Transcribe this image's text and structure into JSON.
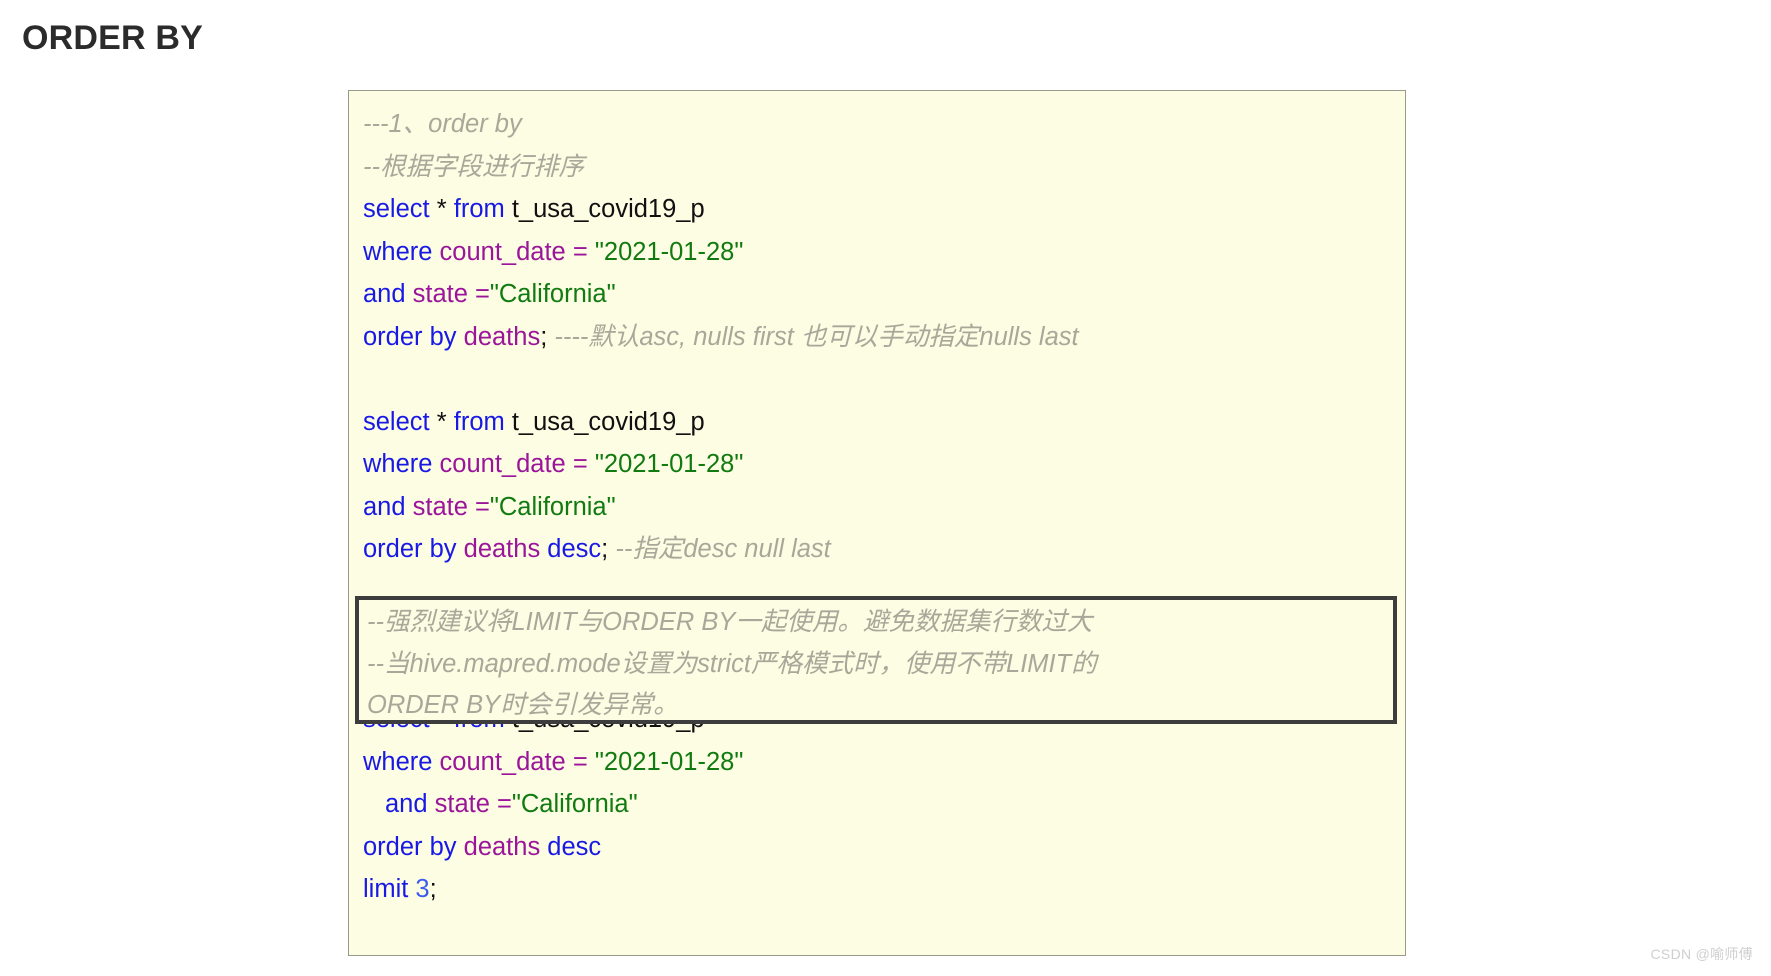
{
  "page": {
    "title": "ORDER BY",
    "watermark": "CSDN @喻师傅",
    "background_color": "#ffffff",
    "card_background_color": "#fdfde3",
    "card_border_color": "#9a9a8a",
    "warning_box_border_color": "#3d3d3d"
  },
  "syntax_colors": {
    "keyword": "#1919e6",
    "column": "#9a159a",
    "string": "#117a11",
    "plain": "#101010",
    "number": "#3b5bf0",
    "comment": "#a8a89a"
  },
  "code": {
    "block1": {
      "comment_title": "---1、order by",
      "comment_desc": "--根据字段进行排序",
      "select_kw": "select",
      "star": "*",
      "from_kw": "from",
      "table": "t_usa_covid19_p",
      "where_kw": "where",
      "col_count_date": "count_date",
      "eq": "=",
      "val_date": "\"2021-01-28\"",
      "and_kw": "and",
      "col_state": "state",
      "eq2": "=",
      "val_state": "\"California\"",
      "orderby_kw": "order by",
      "col_deaths": "deaths",
      "semicolon": ";",
      "trailing_comment": "----默认asc, nulls first 也可以手动指定nulls last"
    },
    "block2": {
      "select_kw": "select",
      "star": "*",
      "from_kw": "from",
      "table": "t_usa_covid19_p",
      "where_kw": "where",
      "col_count_date": "count_date",
      "eq": "=",
      "val_date": "\"2021-01-28\"",
      "and_kw": "and",
      "col_state": "state",
      "eq2": "=",
      "val_state": "\"California\"",
      "orderby_kw": "order by",
      "col_deaths": "deaths",
      "desc_kw": "desc",
      "semicolon": ";",
      "trailing_comment": "--指定desc null last"
    },
    "warning_box": {
      "line1": "--强烈建议将LIMIT与ORDER BY一起使用。避免数据集行数过大",
      "line2": "--当hive.mapred.mode设置为strict严格模式时，使用不带LIMIT的",
      "line3": "ORDER BY时会引发异常。"
    },
    "block3": {
      "select_kw": "select",
      "star": "*",
      "from_kw": "from",
      "table": "t_usa_covid19_p",
      "where_kw": "where",
      "col_count_date": "count_date",
      "eq": "=",
      "val_date": "\"2021-01-28\"",
      "and_kw": "and",
      "col_state": "state",
      "eq2": "=",
      "val_state": "\"California\"",
      "orderby_kw": "order by",
      "col_deaths": "deaths",
      "desc_kw": "desc",
      "limit_kw": "limit",
      "limit_num": "3",
      "semicolon": ";"
    }
  }
}
